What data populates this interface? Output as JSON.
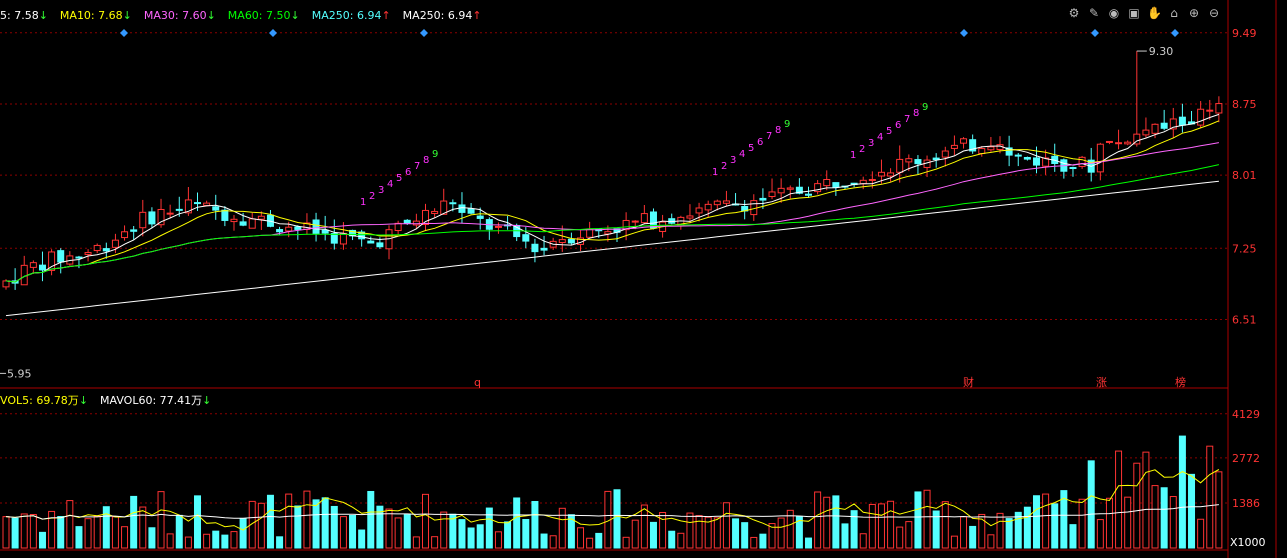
{
  "colors": {
    "up": "#ff3333",
    "down": "#54ffff",
    "ma5": "#ffffff",
    "ma10": "#ffff00",
    "ma30": "#ff66ff",
    "ma60": "#00ff00",
    "ma250": "#ffffff",
    "grid": "#8b0000",
    "axis_text": "#ff3333",
    "td_seq": "#ff33ff",
    "td_nine": "#33ff33"
  },
  "legend_ma": [
    {
      "label": "5: 7.58",
      "arrow": "↓",
      "color": "#ffffff"
    },
    {
      "label": "MA10: 7.68",
      "arrow": "↓",
      "color": "#ffff00"
    },
    {
      "label": "MA30: 7.60",
      "arrow": "↓",
      "color": "#ff66ff"
    },
    {
      "label": "MA60: 7.50",
      "arrow": "↓",
      "color": "#00ff00"
    },
    {
      "label": "MA250: 6.94",
      "arrow": "↑",
      "color": "#54ffff"
    },
    {
      "label": "MA250: 6.94",
      "arrow": "↑",
      "color": "#ffffff"
    }
  ],
  "legend_vol": [
    {
      "label": "VOL5: 69.78万",
      "arrow": "↓",
      "color": "#ffff00"
    },
    {
      "label": "MAVOL60: 77.41万",
      "arrow": "↓",
      "color": "#ffffff"
    }
  ],
  "toolbar_icons": [
    "settings-icon",
    "pen-icon",
    "eye-icon",
    "lock-icon",
    "hand-icon",
    "home-icon",
    "zoom-in-icon",
    "zoom-out-icon"
  ],
  "chart_data": {
    "type": "candlestick",
    "price_axis": {
      "ticks": [
        "9.49",
        "8.75",
        "8.01",
        "7.25",
        "6.51"
      ],
      "ylim": [
        5.85,
        9.55
      ]
    },
    "volume_axis": {
      "ticks": [
        "4129",
        "2772",
        "1386"
      ],
      "unit": "X1000",
      "ylim": [
        0,
        4400
      ]
    },
    "annotations": {
      "high": "9.30",
      "low": "5.95"
    },
    "event_markers": [
      "q",
      "财",
      "涨",
      "榜"
    ],
    "td_sequences": [
      {
        "labels": [
          "1",
          "2",
          "3",
          "4",
          "5",
          "6",
          "7",
          "8",
          "9"
        ],
        "last_green": "9"
      },
      {
        "labels": [
          "1",
          "2",
          "3",
          "4",
          "5",
          "6",
          "7",
          "8",
          "9"
        ],
        "last_green": "9"
      },
      {
        "labels": [
          "1",
          "2",
          "3",
          "4",
          "5",
          "6",
          "7",
          "8",
          "9"
        ],
        "last_green": "9"
      }
    ]
  }
}
